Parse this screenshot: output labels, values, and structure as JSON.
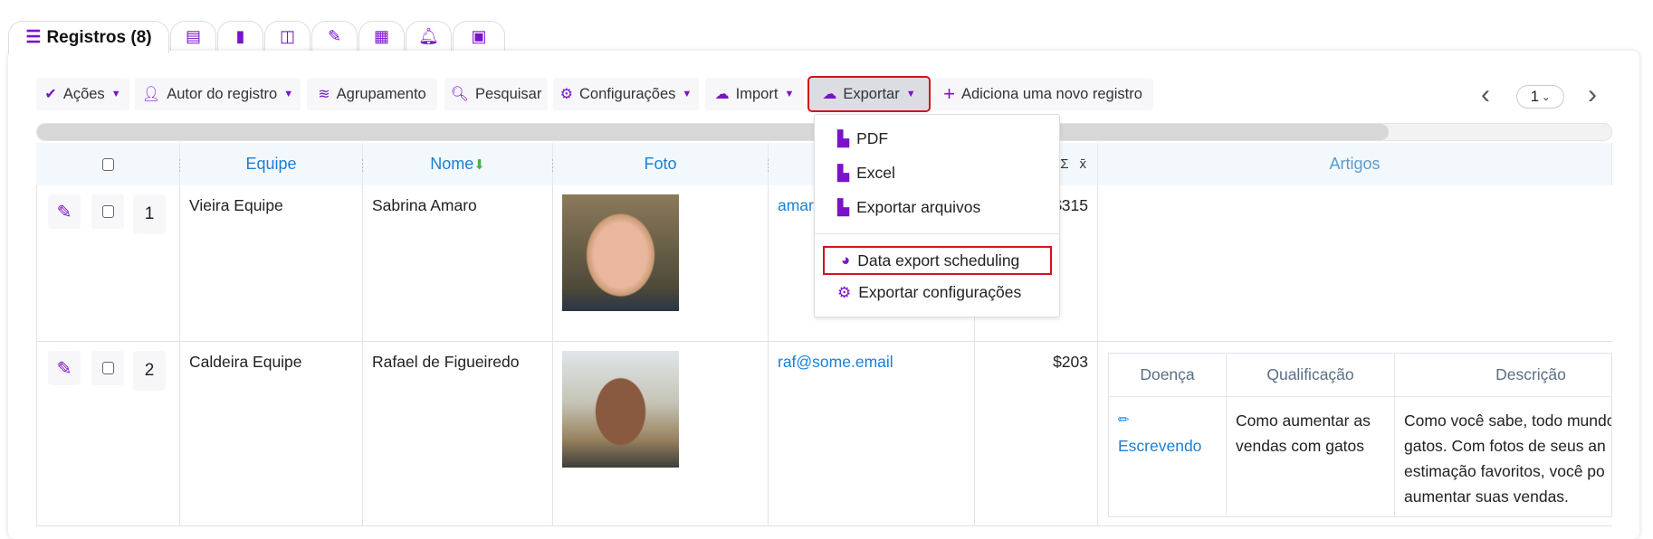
{
  "tabs": {
    "active": {
      "label": "Registros (8)",
      "icon": "list-icon"
    },
    "icons": [
      "table-icon",
      "clipboard-icon",
      "columns-icon",
      "brush-icon",
      "calendar-icon",
      "bell-icon",
      "newspaper-icon"
    ]
  },
  "toolbar": {
    "acoes": "Ações",
    "autor": "Autor do registro",
    "agrupamento": "Agrupamento",
    "pesquisar": "Pesquisar",
    "configuracoes": "Configurações",
    "import": "Import",
    "exportar": "Exportar",
    "adicionar": "Adiciona uma novo registro"
  },
  "pagination": {
    "page": "1",
    "prev": "‹",
    "next": "›"
  },
  "scrollbar": {
    "position_fraction": 0.86
  },
  "columns": {
    "equipe": "Equipe",
    "nome": "Nome",
    "foto": "Foto",
    "sum": "Σ",
    "avg": "x̄",
    "artigos": "Artigos"
  },
  "rows": [
    {
      "num": "1",
      "equipe": "Vieira Equipe",
      "nome": "Sabrina Amaro",
      "email": "amar",
      "valor": "$315"
    },
    {
      "num": "2",
      "equipe": "Caldeira Equipe",
      "nome": "Rafael de Figueiredo",
      "email": "raf@some.email",
      "valor": "$203"
    }
  ],
  "export_menu": {
    "pdf": "PDF",
    "excel": "Excel",
    "arquivos": "Exportar arquivos",
    "scheduling": "Data export scheduling",
    "config": "Exportar configurações"
  },
  "artigos": {
    "headers": {
      "doenca": "Doença",
      "qualificacao": "Qualificação",
      "descricao": "Descrição"
    },
    "row": {
      "doenca": "Escrevendo",
      "qualificacao": [
        "Como aumentar as",
        "vendas com gatos"
      ],
      "descricao": [
        "Como você sabe, todo mundo",
        "gatos. Com fotos de seus an",
        "estimação favoritos, você po",
        "aumentar suas vendas."
      ]
    }
  },
  "colors": {
    "accent": "#7b12c9",
    "link": "#1a7fd6",
    "highlight": "#d0141b"
  }
}
